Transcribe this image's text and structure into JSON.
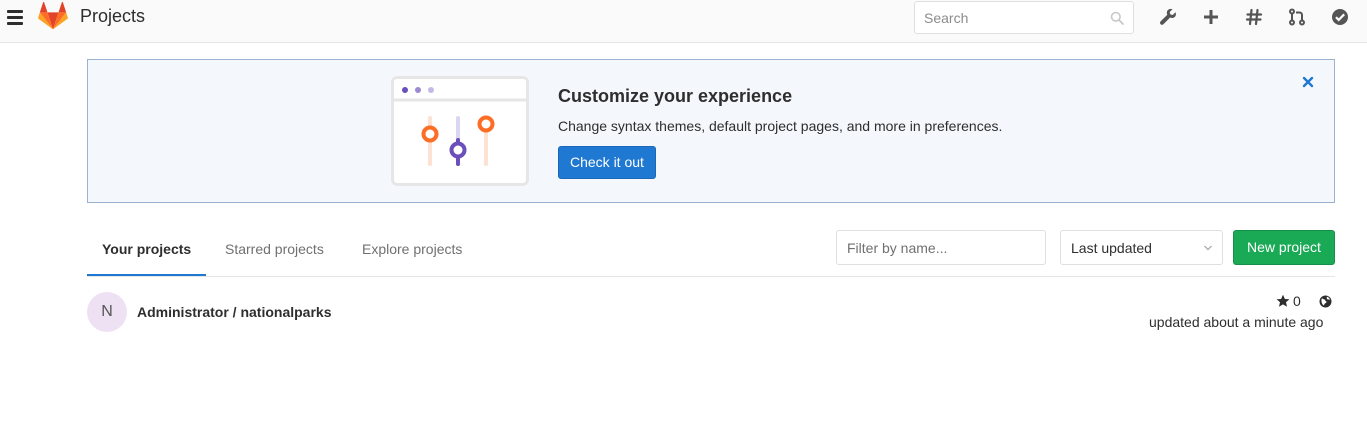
{
  "header": {
    "title": "Projects",
    "search_placeholder": "Search",
    "icons": [
      "hamburger-icon",
      "gitlab-logo",
      "search-icon",
      "wrench-icon",
      "plus-icon",
      "hash-icon",
      "merge-request-icon",
      "todo-check-icon"
    ]
  },
  "callout": {
    "title": "Customize your experience",
    "text": "Change syntax themes, default project pages, and more in preferences.",
    "button_label": "Check it out"
  },
  "tabs": [
    {
      "label": "Your projects",
      "active": true
    },
    {
      "label": "Starred projects",
      "active": false
    },
    {
      "label": "Explore projects",
      "active": false
    }
  ],
  "filter": {
    "placeholder": "Filter by name..."
  },
  "sort": {
    "selected": "Last updated"
  },
  "new_project_label": "New project",
  "projects": [
    {
      "avatar_letter": "N",
      "name": "Administrator / nationalparks",
      "stars": "0",
      "updated": "updated about a minute ago"
    }
  ],
  "colors": {
    "accent_blue": "#1f78d1",
    "success_green": "#1aaa55",
    "callout_bg": "#f4f8fc",
    "orange": "#fc6d26",
    "purple": "#6b4fbb"
  }
}
